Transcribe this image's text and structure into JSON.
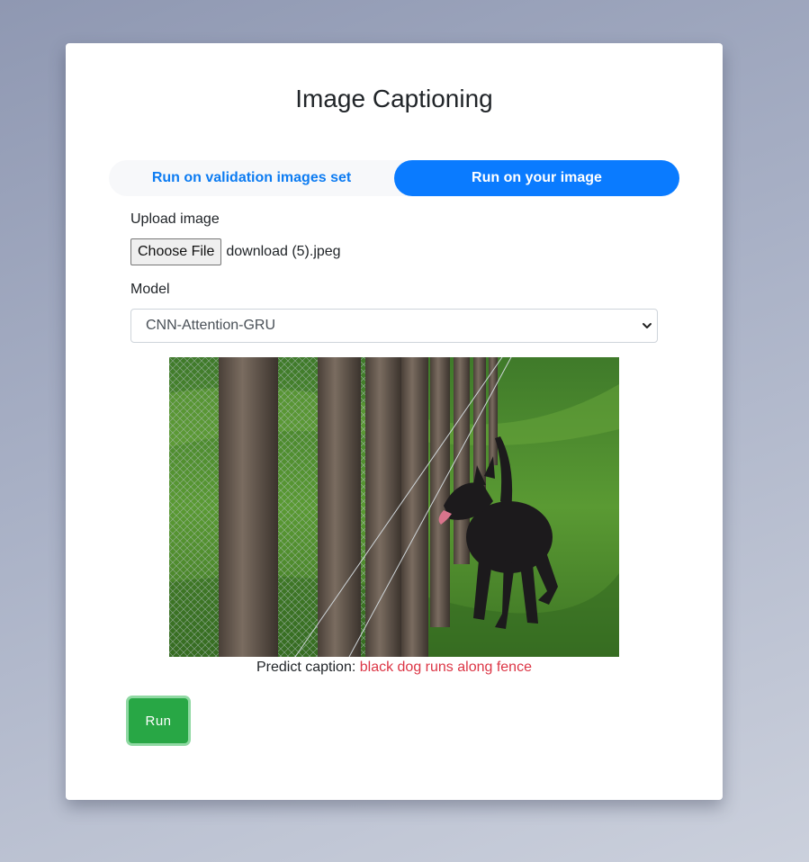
{
  "page": {
    "title": "Image Captioning"
  },
  "tabs": [
    {
      "label": "Run on validation images set",
      "active": false
    },
    {
      "label": "Run on your image",
      "active": true
    }
  ],
  "upload": {
    "label": "Upload image",
    "button_label": "Choose File",
    "file_name": "download (5).jpeg"
  },
  "model": {
    "label": "Model",
    "selected": "CNN-Attention-GRU"
  },
  "image": {
    "subject": "black dog running along a wooden post wire fence on green grass"
  },
  "prediction": {
    "prefix": "Predict caption: ",
    "caption": "black dog runs along fence"
  },
  "run_button": {
    "label": "Run"
  },
  "colors": {
    "tab_active": "#0a7bff",
    "tab_text": "#0d7cf2",
    "run_button": "#28a745",
    "caption_prediction": "#dc3545"
  }
}
